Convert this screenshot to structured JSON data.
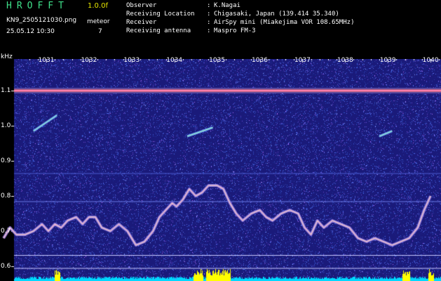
{
  "header": {
    "title": "HROFFT",
    "version": "1.0.0f",
    "filename": "KN9_2505121030.png",
    "datetime": "25.05.12 10:30",
    "meteor_label": "meteor",
    "meteor_count": "7",
    "info": [
      {
        "key": "Observer",
        "value": "K.Nagai"
      },
      {
        "key": "Receiving Location",
        "value": "Chigasaki, Japan (139.414 35.340)"
      },
      {
        "key": "Receiver",
        "value": "AirSpy mini (Miakejima VOR 108.65MHz)"
      },
      {
        "key": "Receiving antenna",
        "value": "Maspro FM-3"
      }
    ]
  },
  "chart_data": {
    "type": "heatmap",
    "y_unit_label": "kHz",
    "x_ticks": [
      "1031",
      "1032",
      "1033",
      "1034",
      "1035",
      "1036",
      "1037",
      "1038",
      "1039",
      "1040"
    ],
    "y_ticks": [
      "1.1",
      "1.0",
      "0.9",
      "0.8",
      "0.7",
      "0.6"
    ],
    "ylim": [
      0.58,
      1.2
    ],
    "colors": {
      "background": "#1a1a7a",
      "carrier": "#ff7fb0",
      "meteor": "#a0ffb0",
      "baseline": "#00d8ff",
      "burst": "#ffff00"
    },
    "carrier_khz": 1.1,
    "meteors": [
      {
        "start": [
          1030.7,
          0.985
        ],
        "end": [
          1031.25,
          1.03
        ]
      },
      {
        "start": [
          1034.3,
          0.97
        ],
        "end": [
          1034.9,
          0.995
        ]
      },
      {
        "start": [
          1038.8,
          0.97
        ],
        "end": [
          1039.1,
          0.985
        ]
      }
    ],
    "drift_trace": [
      [
        1030.0,
        0.68
      ],
      [
        1030.15,
        0.71
      ],
      [
        1030.3,
        0.69
      ],
      [
        1030.5,
        0.69
      ],
      [
        1030.7,
        0.7
      ],
      [
        1030.9,
        0.72
      ],
      [
        1031.05,
        0.7
      ],
      [
        1031.2,
        0.72
      ],
      [
        1031.35,
        0.71
      ],
      [
        1031.5,
        0.73
      ],
      [
        1031.7,
        0.74
      ],
      [
        1031.85,
        0.72
      ],
      [
        1032.0,
        0.74
      ],
      [
        1032.15,
        0.74
      ],
      [
        1032.3,
        0.71
      ],
      [
        1032.5,
        0.7
      ],
      [
        1032.7,
        0.72
      ],
      [
        1032.9,
        0.7
      ],
      [
        1033.1,
        0.66
      ],
      [
        1033.3,
        0.67
      ],
      [
        1033.5,
        0.7
      ],
      [
        1033.65,
        0.74
      ],
      [
        1033.8,
        0.76
      ],
      [
        1033.95,
        0.78
      ],
      [
        1034.05,
        0.77
      ],
      [
        1034.2,
        0.79
      ],
      [
        1034.35,
        0.82
      ],
      [
        1034.5,
        0.8
      ],
      [
        1034.65,
        0.81
      ],
      [
        1034.8,
        0.83
      ],
      [
        1035.0,
        0.83
      ],
      [
        1035.15,
        0.82
      ],
      [
        1035.3,
        0.78
      ],
      [
        1035.45,
        0.75
      ],
      [
        1035.6,
        0.73
      ],
      [
        1035.8,
        0.75
      ],
      [
        1036.0,
        0.76
      ],
      [
        1036.15,
        0.74
      ],
      [
        1036.3,
        0.73
      ],
      [
        1036.5,
        0.75
      ],
      [
        1036.7,
        0.76
      ],
      [
        1036.9,
        0.75
      ],
      [
        1037.05,
        0.71
      ],
      [
        1037.2,
        0.69
      ],
      [
        1037.35,
        0.73
      ],
      [
        1037.5,
        0.71
      ],
      [
        1037.7,
        0.73
      ],
      [
        1037.9,
        0.72
      ],
      [
        1038.1,
        0.71
      ],
      [
        1038.3,
        0.68
      ],
      [
        1038.5,
        0.67
      ],
      [
        1038.7,
        0.68
      ],
      [
        1038.9,
        0.67
      ],
      [
        1039.1,
        0.66
      ],
      [
        1039.3,
        0.67
      ],
      [
        1039.5,
        0.68
      ],
      [
        1039.7,
        0.71
      ],
      [
        1039.85,
        0.76
      ],
      [
        1040.0,
        0.8
      ]
    ],
    "bursts": [
      [
        1031.2,
        1031.3
      ],
      [
        1034.45,
        1034.65
      ],
      [
        1034.75,
        1035.3
      ],
      [
        1039.35,
        1039.5
      ],
      [
        1039.95,
        1040.05
      ]
    ]
  }
}
